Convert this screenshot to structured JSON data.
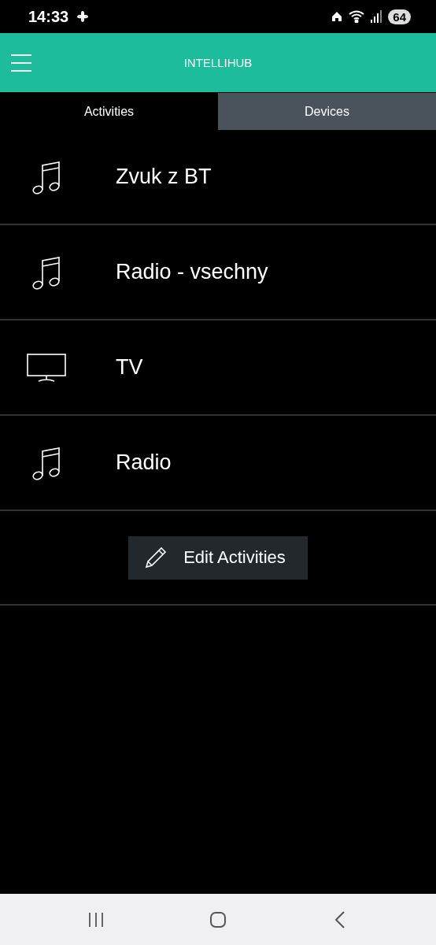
{
  "status_bar": {
    "time": "14:33",
    "battery": "64"
  },
  "header": {
    "title": "INTELLIHUB"
  },
  "tabs": [
    {
      "label": "Activities",
      "selected": true
    },
    {
      "label": "Devices",
      "selected": false
    }
  ],
  "activities": [
    {
      "name": "Zvuk z BT",
      "kind": "music"
    },
    {
      "name": "Radio - vsechny",
      "kind": "music"
    },
    {
      "name": "TV",
      "kind": "tv"
    },
    {
      "name": "Radio",
      "kind": "music"
    }
  ],
  "edit_button": {
    "label": "Edit Activities"
  }
}
